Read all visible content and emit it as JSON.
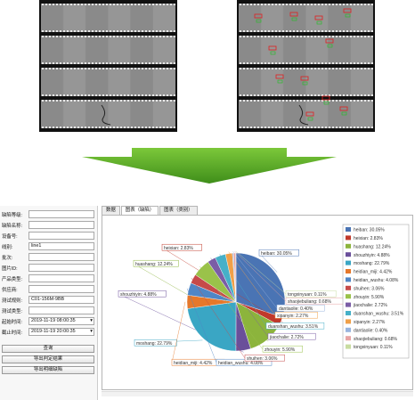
{
  "form": {
    "fields": [
      {
        "label": "缺陷等级:",
        "value": ""
      },
      {
        "label": "缺陷名称:",
        "value": ""
      },
      {
        "label": "设备号:",
        "value": ""
      },
      {
        "label": "线别:",
        "value": "line1"
      },
      {
        "label": "批次:",
        "value": ""
      },
      {
        "label": "图片ID:",
        "value": ""
      },
      {
        "label": "产品类型:",
        "value": ""
      },
      {
        "label": "供应商:",
        "value": ""
      },
      {
        "label": "测试规则:",
        "value": "C01-156M-9BB"
      },
      {
        "label": "测试类型:",
        "value": ""
      },
      {
        "label": "起始时间:",
        "value": "2019-11-19 08:00:35"
      },
      {
        "label": "截止时间:",
        "value": "2019-11-19 20:00:35"
      }
    ],
    "buttons": [
      "查询",
      "导出判定结果",
      "导出明细缺陷"
    ]
  },
  "tabs": [
    {
      "label": "数据",
      "active": false
    },
    {
      "label": "图表（缺陷）",
      "active": true
    },
    {
      "label": "图表（类别）",
      "active": false
    }
  ],
  "chart_data": {
    "type": "pie",
    "slices": [
      {
        "name": "heiban",
        "value": 30.05,
        "color": "#4a74b4"
      },
      {
        "name": "heixian",
        "value": 2.83,
        "color": "#c0392b"
      },
      {
        "name": "huashang",
        "value": 12.24,
        "color": "#8cb43c"
      },
      {
        "name": "shouzhiyin",
        "value": 4.88,
        "color": "#6a4f9a"
      },
      {
        "name": "moshang",
        "value": 22.79,
        "color": "#3aa6c4"
      },
      {
        "name": "heidian_miji",
        "value": 4.42,
        "color": "#e6782a"
      },
      {
        "name": "heidian_wushu",
        "value": 4.08,
        "color": "#4f86c6"
      },
      {
        "name": "shuihen",
        "value": 3.06,
        "color": "#c64a4a"
      },
      {
        "name": "zhouyin",
        "value": 5.9,
        "color": "#9ac24a"
      },
      {
        "name": "jiaochalie",
        "value": 2.72,
        "color": "#7b5da6"
      },
      {
        "name": "duanshan_wushu",
        "value": 3.51,
        "color": "#46b0c8"
      },
      {
        "name": "xipanyin",
        "value": 2.27,
        "color": "#f0a048"
      },
      {
        "name": "dantiaolie",
        "value": 0.4,
        "color": "#98b4de"
      },
      {
        "name": "shaojiebuliang",
        "value": 0.68,
        "color": "#e8a4a4"
      },
      {
        "name": "tongxinyuan",
        "value": 0.11,
        "color": "#c8dca0"
      }
    ],
    "labels": [
      "heiban: 30.05%",
      "heixian: 2.83%",
      "huashang: 12.24%",
      "shouzhiyin: 4.88%",
      "moshang: 22.79%",
      "heidian_miji: 4.42%",
      "heidian_wushu: 4.08%",
      "shuihen: 3.06%",
      "zhouyin: 5.90%",
      "jiaochalie: 2.72%",
      "duanshan_wushu: 3.51%",
      "xipanyin: 2.27%",
      "dantiaolie: 0.40%",
      "shaojiebuliang: 0.68%",
      "tongxinyuan: 0.11%"
    ],
    "legend_position": "right"
  }
}
